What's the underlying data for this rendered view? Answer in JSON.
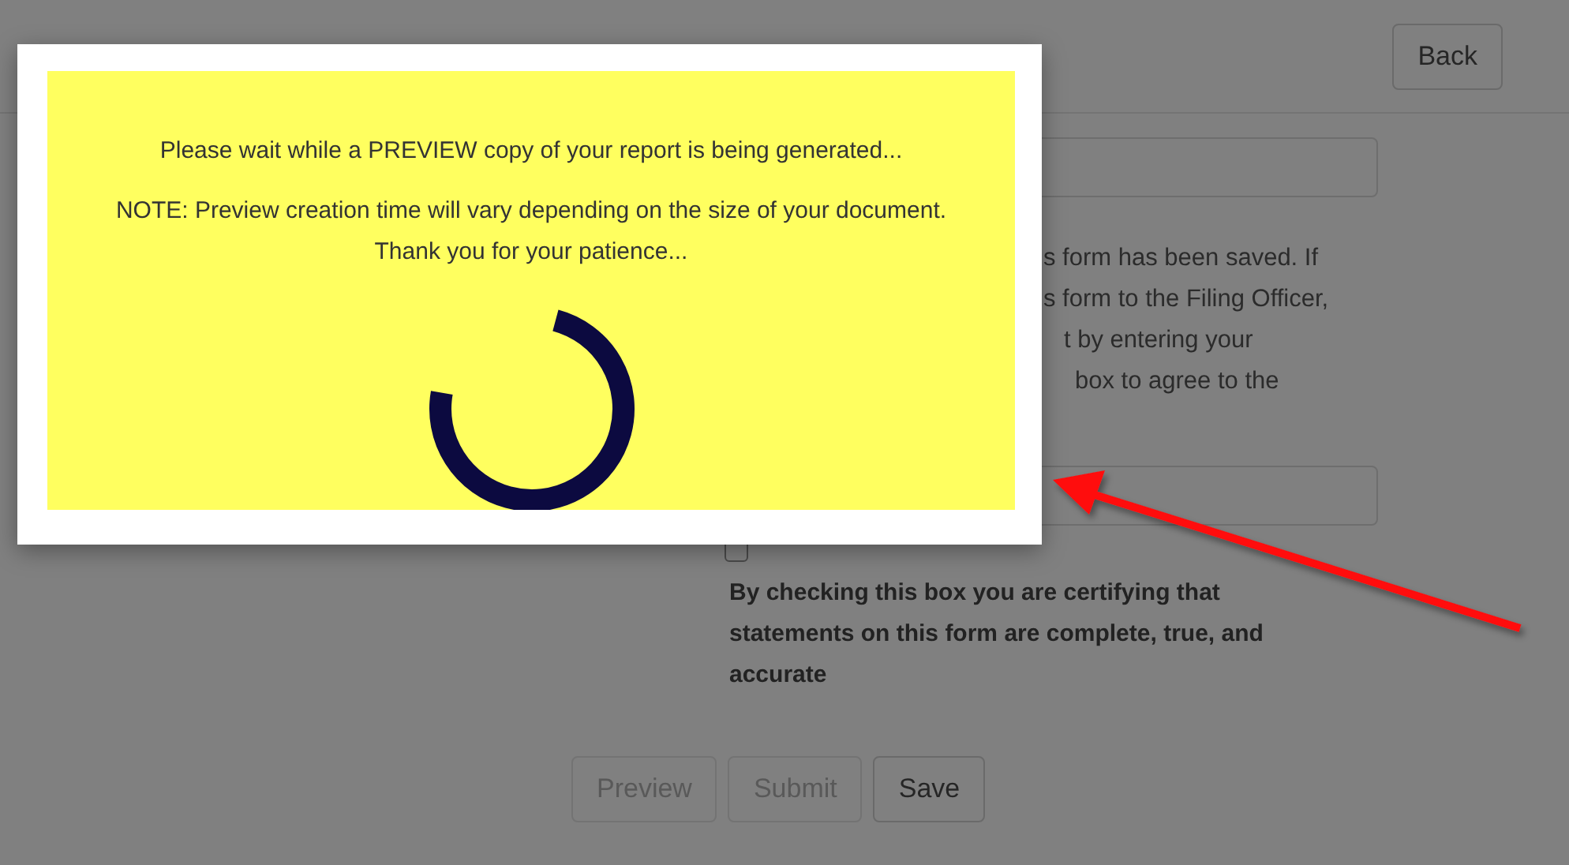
{
  "header": {
    "back_button": "Back"
  },
  "form": {
    "paragraph_fragments": [
      "s form has been saved. If",
      "s form to the Filing Officer,",
      "t by entering your",
      "box to agree to the"
    ],
    "certify": {
      "checked": false,
      "label": "By checking this box you are certifying that statements on this form are complete, true, and accurate"
    }
  },
  "buttons": [
    {
      "label": "Preview",
      "disabled": true
    },
    {
      "label": "Submit",
      "disabled": true
    },
    {
      "label": "Save",
      "disabled": false
    }
  ],
  "modal": {
    "message": "Please wait while a PREVIEW copy of your report is being generated...",
    "note": "NOTE: Preview creation time will vary depending on the size of your document. Thank you for your patience..."
  }
}
